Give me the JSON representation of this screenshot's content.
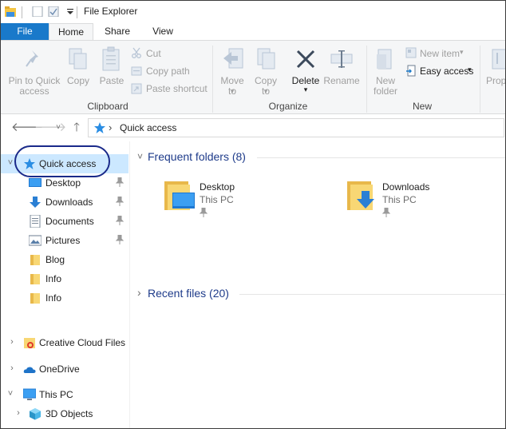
{
  "window": {
    "title": "File Explorer"
  },
  "tabs": {
    "file": "File",
    "home": "Home",
    "share": "Share",
    "view": "View"
  },
  "ribbon": {
    "pin_to_quick_access": "Pin to Quick access",
    "copy": "Copy",
    "paste": "Paste",
    "cut": "Cut",
    "copy_path": "Copy path",
    "paste_shortcut": "Paste shortcut",
    "clipboard_group": "Clipboard",
    "move_to": "Move to",
    "copy_to": "Copy to",
    "delete": "Delete",
    "rename": "Rename",
    "organize_group": "Organize",
    "new_folder": "New folder",
    "new_item": "New item",
    "easy_access": "Easy access",
    "new_group": "New",
    "properties_partial": "Prop"
  },
  "address": {
    "crumb": "Quick access"
  },
  "navpane": {
    "quick_access": "Quick access",
    "items": [
      {
        "label": "Desktop",
        "pinned": true
      },
      {
        "label": "Downloads",
        "pinned": true
      },
      {
        "label": "Documents",
        "pinned": true
      },
      {
        "label": "Pictures",
        "pinned": true
      },
      {
        "label": "Blog",
        "pinned": false
      },
      {
        "label": "Info",
        "pinned": false
      },
      {
        "label": "Info",
        "pinned": false
      }
    ],
    "creative_cloud": "Creative Cloud Files",
    "onedrive": "OneDrive",
    "this_pc": "This PC",
    "objects_3d": "3D Objects"
  },
  "content": {
    "frequent_header": "Frequent folders (8)",
    "recent_header": "Recent files (20)",
    "folders": [
      {
        "name": "Desktop",
        "location": "This PC"
      },
      {
        "name": "Downloads",
        "location": "This PC"
      }
    ]
  },
  "colors": {
    "accent": "#1979ca",
    "selected": "#cce8ff",
    "header_text": "#1e3b8a",
    "oval": "#1a2a8a"
  }
}
